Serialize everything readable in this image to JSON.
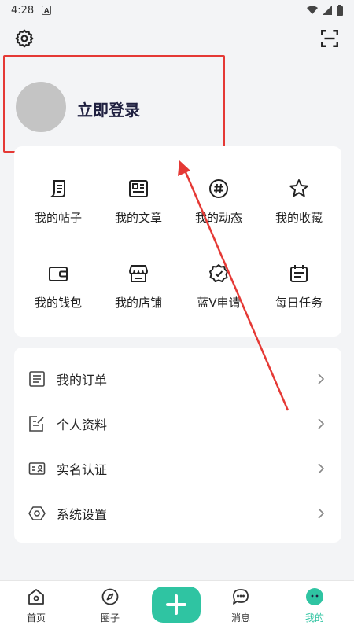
{
  "status_bar": {
    "time": "4:28",
    "badge": "A"
  },
  "profile": {
    "login_label": "立即登录"
  },
  "grid": [
    {
      "label": "我的帖子",
      "icon": "post-icon"
    },
    {
      "label": "我的文章",
      "icon": "article-icon"
    },
    {
      "label": "我的动态",
      "icon": "hashtag-icon"
    },
    {
      "label": "我的收藏",
      "icon": "star-icon"
    },
    {
      "label": "我的钱包",
      "icon": "wallet-icon"
    },
    {
      "label": "我的店铺",
      "icon": "store-icon"
    },
    {
      "label": "蓝V申请",
      "icon": "verified-badge-icon"
    },
    {
      "label": "每日任务",
      "icon": "calendar-icon"
    }
  ],
  "list": [
    {
      "label": "我的订单",
      "icon": "order-icon"
    },
    {
      "label": "个人资料",
      "icon": "profile-edit-icon"
    },
    {
      "label": "实名认证",
      "icon": "id-card-icon"
    },
    {
      "label": "系统设置",
      "icon": "settings-hex-icon"
    }
  ],
  "nav": [
    {
      "label": "首页",
      "icon": "home-icon"
    },
    {
      "label": "圈子",
      "icon": "compass-icon"
    },
    {
      "label": "消息",
      "icon": "message-icon"
    },
    {
      "label": "我的",
      "icon": "profile-face-icon",
      "active": true
    }
  ],
  "colors": {
    "accent": "#2fc4a2",
    "highlight": "#e53935"
  }
}
